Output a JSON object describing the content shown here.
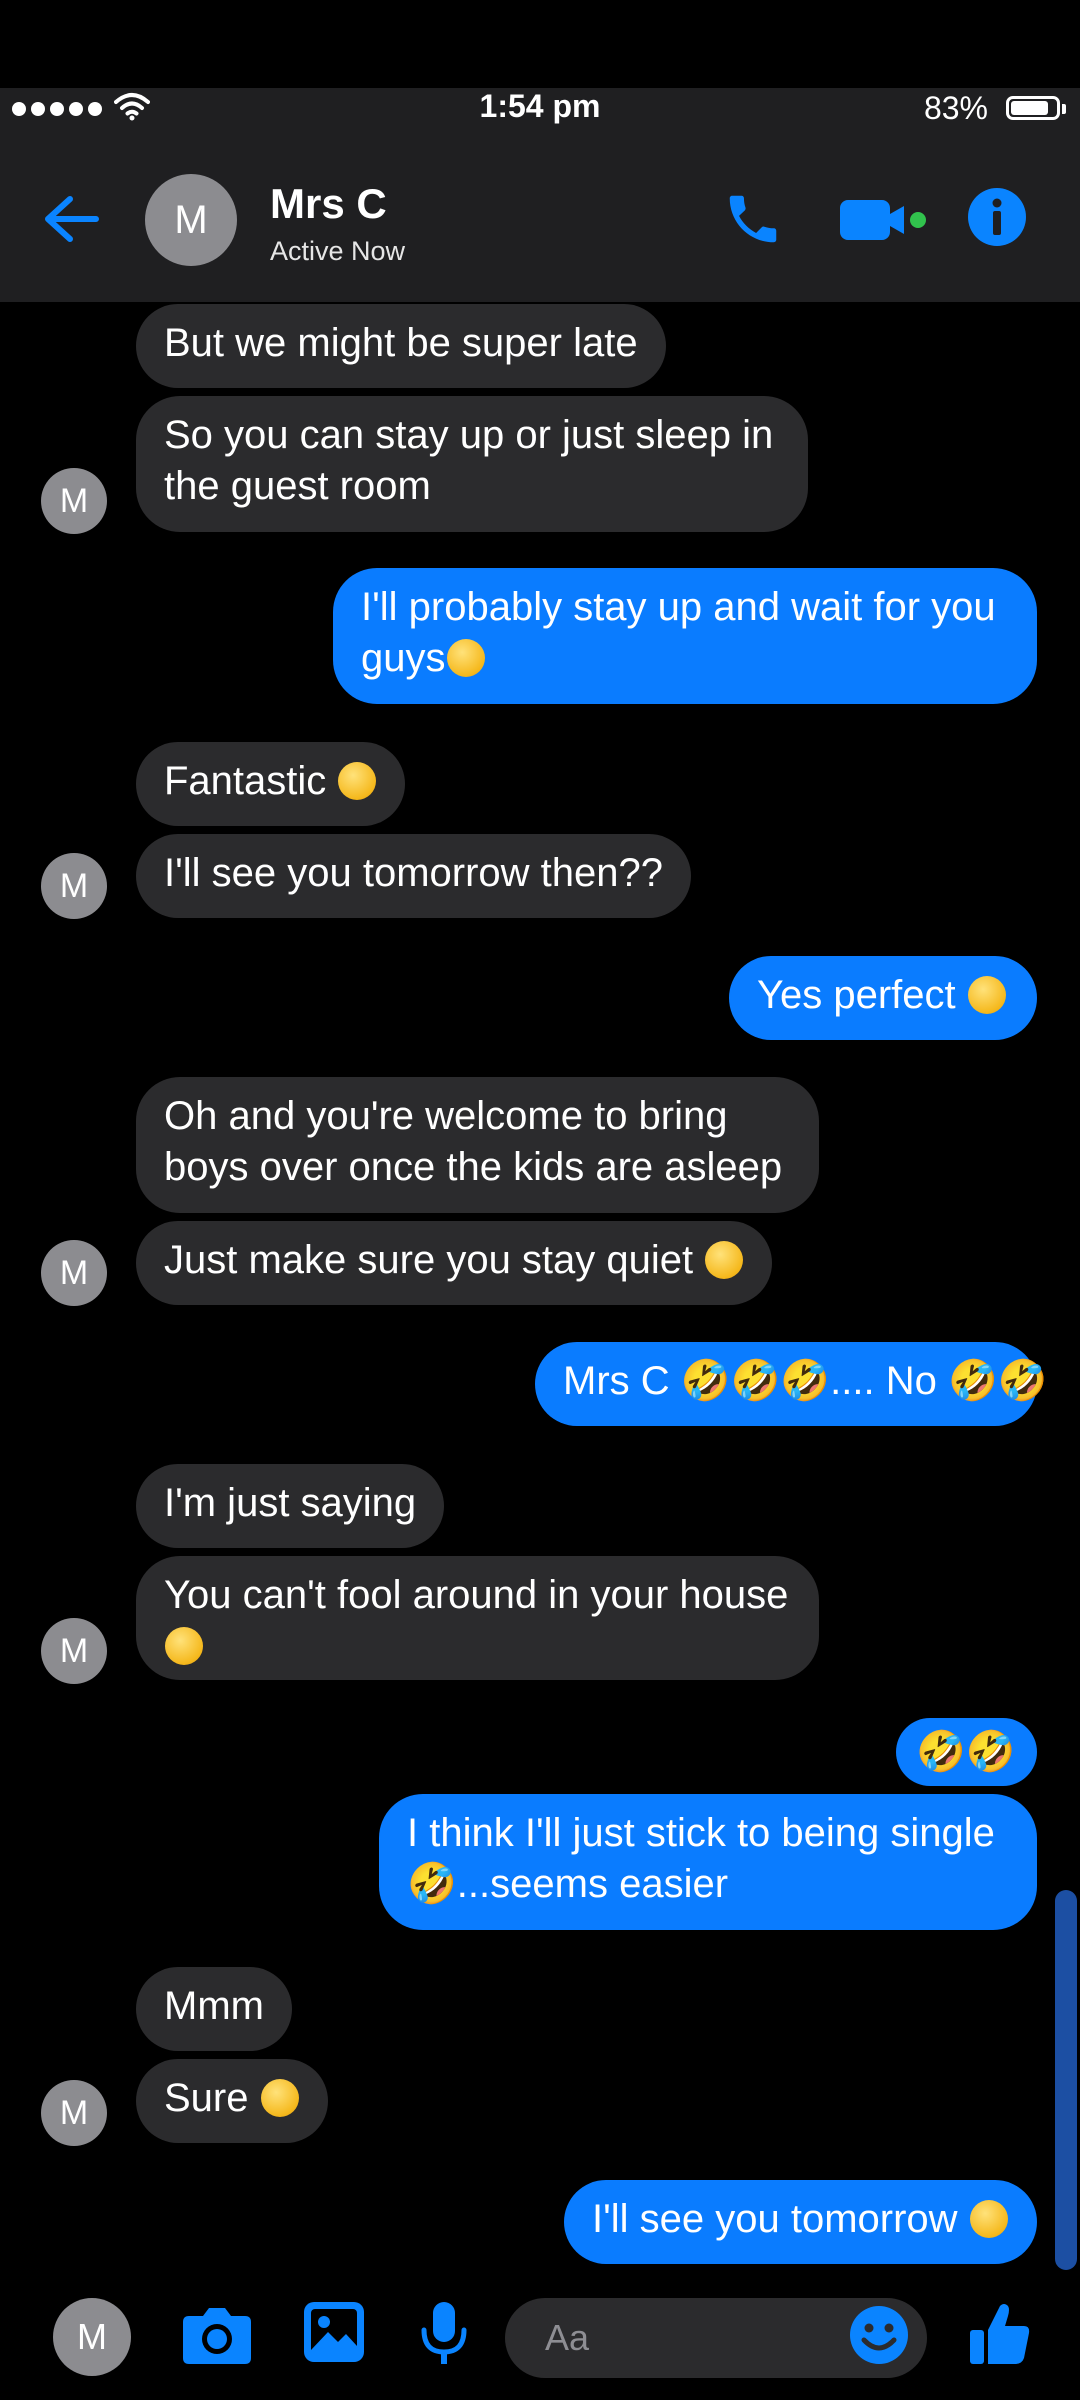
{
  "status_bar": {
    "time": "1:54 pm",
    "battery": "83%",
    "battery_level": 0.83
  },
  "header": {
    "contact_initial": "M",
    "contact_name": "Mrs C",
    "contact_status": "Active Now",
    "icons": [
      "back-arrow-icon",
      "phone-icon",
      "video-camera-icon",
      "info-icon"
    ]
  },
  "avatar_initial": "M",
  "messages": [
    {
      "dir": "in",
      "lines": [
        "But we might be super late"
      ]
    },
    {
      "dir": "in",
      "lines": [
        "So you can stay up or just sleep in",
        "the guest room"
      ]
    },
    {
      "dir": "out",
      "lines": [
        "I'll probably stay up and wait for you",
        "guys"
      ],
      "trailing_emoji": "🤭"
    },
    {
      "dir": "in",
      "lines": [
        "Fantastic "
      ],
      "trailing_emoji": "😘"
    },
    {
      "dir": "in",
      "lines": [
        "I'll see you tomorrow then??"
      ]
    },
    {
      "dir": "out",
      "lines": [
        "Yes perfect "
      ],
      "trailing_emoji": "🤭"
    },
    {
      "dir": "in",
      "lines": [
        "Oh and you're welcome to bring",
        "boys over once the kids are asleep"
      ]
    },
    {
      "dir": "in",
      "lines": [
        "Just make sure you stay quiet "
      ],
      "trailing_emoji": "😉"
    },
    {
      "dir": "out",
      "text": "Mrs C 🤣🤣🤣.... No 🤣🤣"
    },
    {
      "dir": "in",
      "lines": [
        "I'm just saying"
      ]
    },
    {
      "dir": "in",
      "lines": [
        "You can't fool around in your house"
      ],
      "second_line_emoji": "🙄"
    },
    {
      "dir": "out",
      "text": "🤣🤣"
    },
    {
      "dir": "out",
      "lines": [
        "I think I'll just stick to being single",
        "🤣...seems easier"
      ]
    },
    {
      "dir": "in",
      "lines": [
        "Mmm"
      ]
    },
    {
      "dir": "in",
      "lines": [
        "Sure "
      ],
      "trailing_emoji": "😉"
    },
    {
      "dir": "out",
      "lines": [
        "I'll see you tomorrow "
      ],
      "trailing_emoji": "🤭"
    }
  ],
  "composer": {
    "avatar_initial": "M",
    "placeholder": "Aa",
    "icons": [
      "camera-icon",
      "gallery-icon",
      "microphone-icon",
      "emoji-icon",
      "thumbs-up-icon"
    ]
  },
  "colors": {
    "incoming_bubble": "#2b2b2d",
    "outgoing_bubble": "#0a7cff",
    "accent": "#0a84ff",
    "background": "#000000"
  }
}
